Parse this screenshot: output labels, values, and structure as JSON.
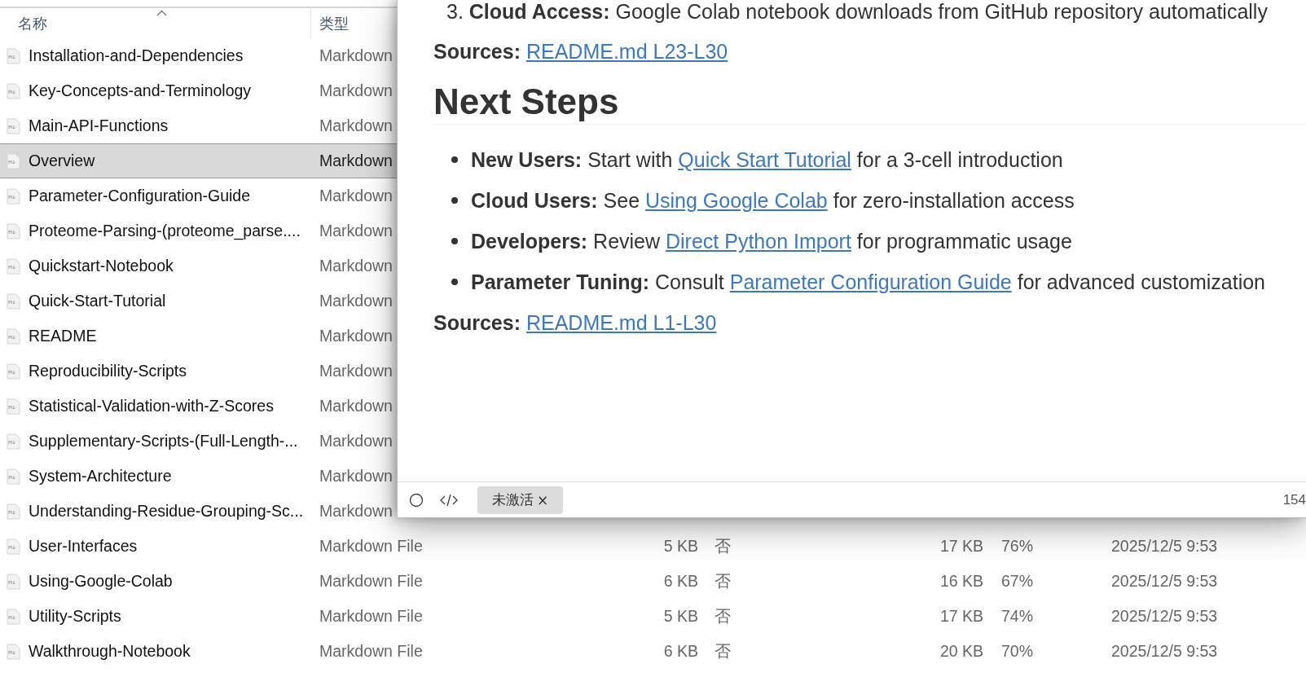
{
  "explorer": {
    "columns": [
      {
        "label": "名称",
        "sorted": true
      },
      {
        "label": "类型"
      }
    ],
    "files": [
      {
        "name": "Installation-and-Dependencies",
        "type": "Markdown",
        "selected": false
      },
      {
        "name": "Key-Concepts-and-Terminology",
        "type": "Markdown",
        "selected": false
      },
      {
        "name": "Main-API-Functions",
        "type": "Markdown",
        "selected": false
      },
      {
        "name": "Overview",
        "type": "Markdown",
        "selected": true
      },
      {
        "name": "Parameter-Configuration-Guide",
        "type": "Markdown",
        "selected": false
      },
      {
        "name": "Proteome-Parsing-(proteome_parse....",
        "type": "Markdown",
        "selected": false
      },
      {
        "name": "Quickstart-Notebook",
        "type": "Markdown",
        "selected": false
      },
      {
        "name": "Quick-Start-Tutorial",
        "type": "Markdown",
        "selected": false
      },
      {
        "name": "README",
        "type": "Markdown",
        "selected": false
      },
      {
        "name": "Reproducibility-Scripts",
        "type": "Markdown",
        "selected": false
      },
      {
        "name": "Statistical-Validation-with-Z-Scores",
        "type": "Markdown",
        "selected": false
      },
      {
        "name": "Supplementary-Scripts-(Full-Length-...",
        "type": "Markdown",
        "selected": false
      },
      {
        "name": "System-Architecture",
        "type": "Markdown",
        "selected": false
      },
      {
        "name": "Understanding-Residue-Grouping-Sc...",
        "type": "Markdown",
        "selected": false
      },
      {
        "name": "User-Interfaces",
        "type": "Markdown File",
        "column_3": "5 KB",
        "column_4": "否",
        "column_5": "17 KB",
        "column_6": "76%",
        "column_7": "2025/12/5 9:53",
        "selected": false
      },
      {
        "name": "Using-Google-Colab",
        "type": "Markdown File",
        "column_3": "6 KB",
        "column_4": "否",
        "column_5": "16 KB",
        "column_6": "67%",
        "column_7": "2025/12/5 9:53",
        "selected": false
      },
      {
        "name": "Utility-Scripts",
        "type": "Markdown File",
        "column_3": "5 KB",
        "column_4": "否",
        "column_5": "17 KB",
        "column_6": "74%",
        "column_7": "2025/12/5 9:53",
        "selected": false
      },
      {
        "name": "Walkthrough-Notebook",
        "type": "Markdown File",
        "column_3": "6 KB",
        "column_4": "否",
        "column_5": "20 KB",
        "column_6": "70%",
        "column_7": "2025/12/5 9:53",
        "selected": false
      }
    ]
  },
  "document": {
    "list_tail": {
      "number": "3.",
      "label": "Cloud Access:",
      "text": "Google Colab notebook downloads from GitHub repository automatically"
    },
    "sources_top": {
      "label": "Sources:",
      "link": "README.md L23-L30"
    },
    "heading": "Next Steps",
    "bullets": [
      {
        "label": "New Users:",
        "before": "Start with",
        "link": "Quick Start Tutorial",
        "after": "for a 3-cell introduction"
      },
      {
        "label": "Cloud Users:",
        "before": "See",
        "link": "Using Google Colab",
        "after": "for zero-installation access"
      },
      {
        "label": "Developers:",
        "before": "Review",
        "link": "Direct Python Import",
        "after": "for programmatic usage"
      },
      {
        "label": "Parameter Tuning:",
        "before": "Consult",
        "link": "Parameter Configuration Guide",
        "after": "for advanced customization"
      }
    ],
    "sources_bottom": {
      "label": "Sources:",
      "link": "README.md L1-L30"
    }
  },
  "status_bar": {
    "tag": {
      "label": "未激活",
      "close": "×"
    },
    "count": "154"
  }
}
